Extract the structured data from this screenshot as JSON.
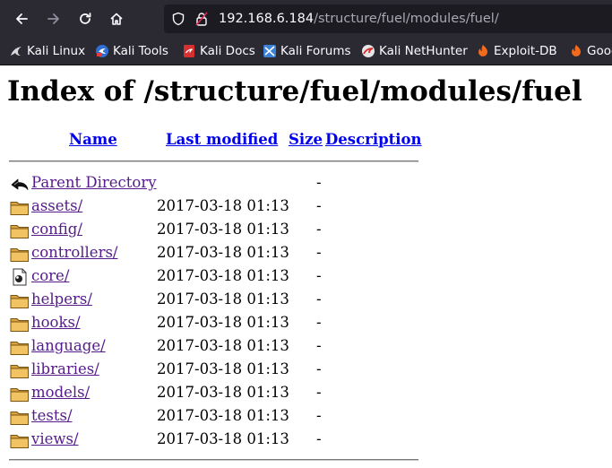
{
  "browser": {
    "url_host": "192.168.6.184",
    "url_path": "/structure/fuel/modules/fuel/",
    "bookmarks": [
      {
        "label": "Kali Linux",
        "icon": "kali-dragon-icon"
      },
      {
        "label": "Kali Tools",
        "icon": "kali-tools-icon"
      },
      {
        "label": "Kali Docs",
        "icon": "kali-docs-icon"
      },
      {
        "label": "Kali Forums",
        "icon": "kali-forums-icon"
      },
      {
        "label": "Kali NetHunter",
        "icon": "kali-nethunter-icon"
      },
      {
        "label": "Exploit-DB",
        "icon": "exploit-db-icon"
      },
      {
        "label": "Goog",
        "icon": "exploit-db-icon"
      }
    ]
  },
  "page": {
    "title": "Index of /structure/fuel/modules/fuel",
    "columns": {
      "name": "Name",
      "last_modified": "Last modified",
      "size": "Size",
      "description": "Description"
    },
    "parent": {
      "name": "Parent Directory",
      "size": "-"
    },
    "entries": [
      {
        "name": "assets/",
        "modified": "2017-03-18 01:13",
        "size": "-",
        "icon": "folder-icon"
      },
      {
        "name": "config/",
        "modified": "2017-03-18 01:13",
        "size": "-",
        "icon": "folder-icon"
      },
      {
        "name": "controllers/",
        "modified": "2017-03-18 01:13",
        "size": "-",
        "icon": "folder-icon"
      },
      {
        "name": "core/",
        "modified": "2017-03-18 01:13",
        "size": "-",
        "icon": "core-file-icon"
      },
      {
        "name": "helpers/",
        "modified": "2017-03-18 01:13",
        "size": "-",
        "icon": "folder-icon"
      },
      {
        "name": "hooks/",
        "modified": "2017-03-18 01:13",
        "size": "-",
        "icon": "folder-icon"
      },
      {
        "name": "language/",
        "modified": "2017-03-18 01:13",
        "size": "-",
        "icon": "folder-icon"
      },
      {
        "name": "libraries/",
        "modified": "2017-03-18 01:13",
        "size": "-",
        "icon": "folder-icon"
      },
      {
        "name": "models/",
        "modified": "2017-03-18 01:13",
        "size": "-",
        "icon": "folder-icon"
      },
      {
        "name": "tests/",
        "modified": "2017-03-18 01:13",
        "size": "-",
        "icon": "folder-icon"
      },
      {
        "name": "views/",
        "modified": "2017-03-18 01:13",
        "size": "-",
        "icon": "folder-icon"
      }
    ]
  }
}
